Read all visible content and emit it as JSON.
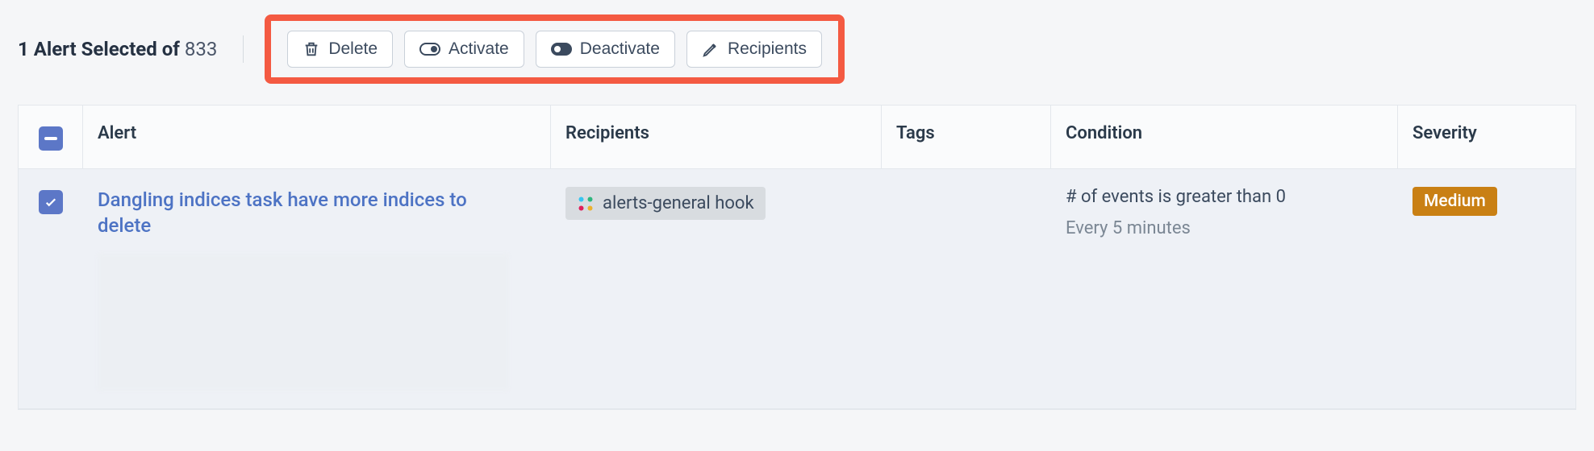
{
  "header": {
    "selected_label_prefix": "1 Alert Selected of",
    "total_count": "833"
  },
  "actions": {
    "delete": "Delete",
    "activate": "Activate",
    "deactivate": "Deactivate",
    "recipients": "Recipients"
  },
  "table": {
    "headers": {
      "alert": "Alert",
      "recipients": "Recipients",
      "tags": "Tags",
      "condition": "Condition",
      "severity": "Severity"
    },
    "rows": [
      {
        "alert_title": "Dangling indices task have more indices to delete",
        "recipient": "alerts-general hook",
        "tags": "",
        "condition_main": "# of events is greater than 0",
        "condition_sub": "Every 5 minutes",
        "severity": "Medium"
      }
    ]
  }
}
